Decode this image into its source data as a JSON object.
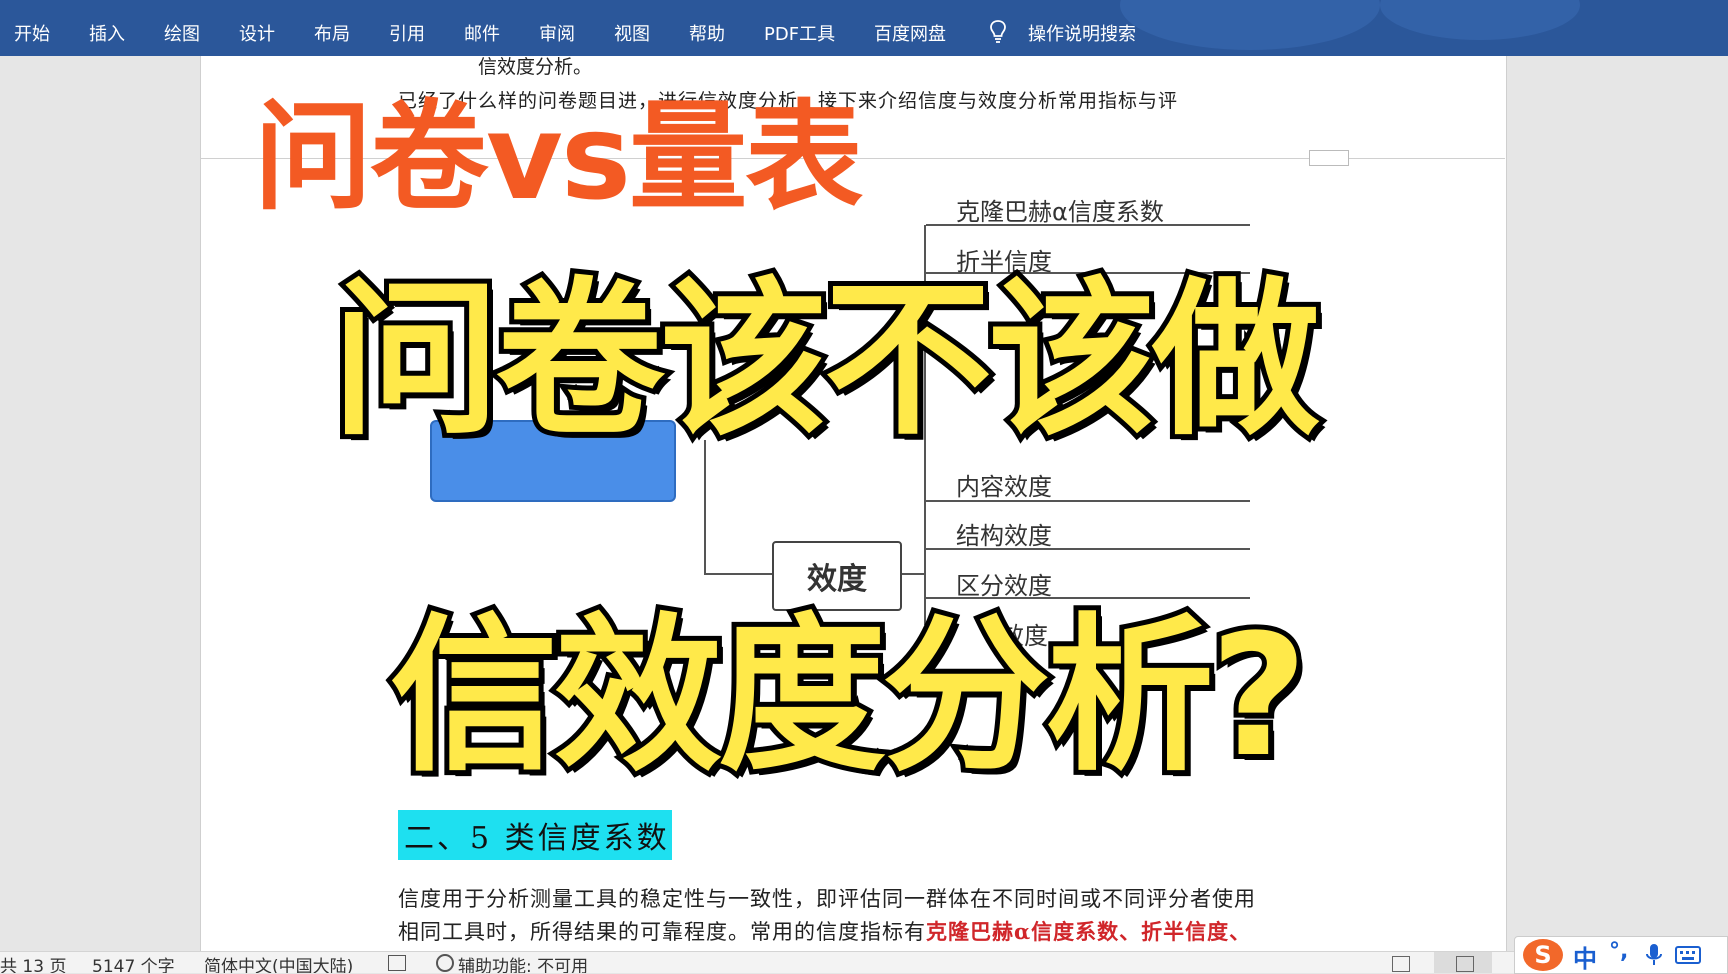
{
  "ribbon": {
    "tabs": [
      "开始",
      "插入",
      "绘图",
      "设计",
      "布局",
      "引用",
      "邮件",
      "审阅",
      "视图",
      "帮助",
      "PDF工具",
      "百度网盘"
    ],
    "search_label": "操作说明搜索"
  },
  "document": {
    "top_line1": "信效度分析。",
    "top_line2": "已经了什么样的问卷题目进，进行信效度分析，接下来介绍信度与效度分析常用指标与评",
    "mindmap": {
      "reliability_items": [
        "克隆巴赫α信度系数",
        "折半信度"
      ],
      "validity_items": [
        "内容效度",
        "结构效度",
        "区分效度",
        "效度"
      ],
      "validity_node": "效度"
    },
    "heading": "二、5 类信度系数",
    "para_line1": "信度用于分析测量工具的稳定性与一致性，即评估同一群体在不同时间或不同评分者使用",
    "para_line2_plain": "相同工具时，所得结果的可靠程度。常用的信度指标有",
    "para_line2_red": "克隆巴赫α信度系数、折半信度、"
  },
  "overlay": {
    "title": "问卷vs量表",
    "line1": "问卷该不该做",
    "line2": "信效度分析?"
  },
  "status": {
    "pages": "共 13 页",
    "words": "5147 个字",
    "language": "简体中文(中国大陆)",
    "accessibility": "辅助功能: 不可用"
  },
  "ime": {
    "mode": "中"
  },
  "colors": {
    "ribbon": "#2b579a",
    "overlay_orange": "#f35a23",
    "overlay_yellow": "#ffe94a",
    "heading_bg": "#1ee0f0",
    "red_text": "#d0262a"
  }
}
